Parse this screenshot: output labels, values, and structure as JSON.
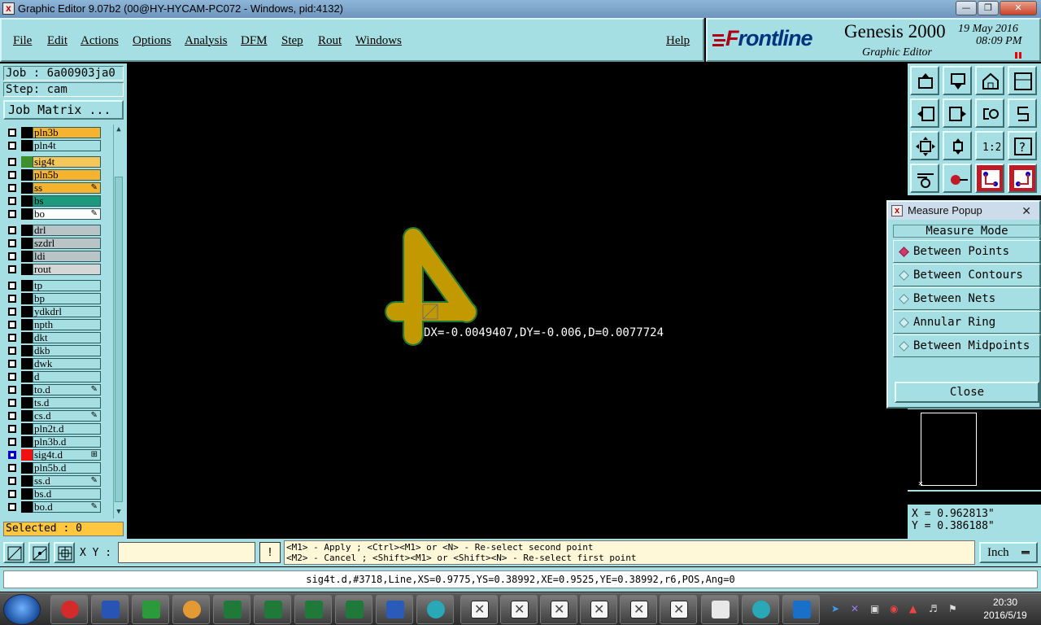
{
  "window": {
    "title": "Graphic Editor 9.07b2 (00@HY-HYCAM-PC072 - Windows, pid:4132)",
    "controls": [
      "minimize",
      "maximize",
      "close"
    ]
  },
  "menubar": {
    "items": [
      "File",
      "Edit",
      "Actions",
      "Options",
      "Analysis",
      "DFM",
      "Step",
      "Rout",
      "Windows"
    ],
    "help": "Help"
  },
  "brand": {
    "logo_first": "F",
    "logo_rest": "rontline",
    "product": "Genesis 2000",
    "subtitle": "Graphic Editor",
    "date": "19 May 2016",
    "time": "08:09 PM"
  },
  "job": {
    "job_label": "Job : 6a00903ja0",
    "step_label": "Step: cam",
    "matrix_button": "Job Matrix ...",
    "selected": "Selected : 0"
  },
  "layers": [
    {
      "name": "pln3b",
      "color": "#f5b330",
      "sq": "#000",
      "checked": false,
      "mark": ""
    },
    {
      "name": "pln4t",
      "color": "#a6dfe3",
      "sq": "#000",
      "checked": false,
      "mark": ""
    },
    {
      "name": "sig4t",
      "color": "#f5c65a",
      "sq": "#3f8f2f",
      "checked": false,
      "mark": ""
    },
    {
      "name": "pln5b",
      "color": "#f5b330",
      "sq": "#000",
      "checked": false,
      "mark": ""
    },
    {
      "name": "ss",
      "color": "#f5b330",
      "sq": "#000",
      "checked": false,
      "mark": "✎"
    },
    {
      "name": "bs",
      "color": "#1d9a7e",
      "sq": "#000",
      "checked": false,
      "mark": ""
    },
    {
      "name": "bo",
      "color": "#ffffff",
      "sq": "#000",
      "checked": false,
      "mark": "✎"
    },
    {
      "name": "drl",
      "color": "#b8c4c6",
      "sq": "#000",
      "checked": false,
      "mark": ""
    },
    {
      "name": "szdrl",
      "color": "#b8c4c6",
      "sq": "#000",
      "checked": false,
      "mark": ""
    },
    {
      "name": "ldi",
      "color": "#b8c4c6",
      "sq": "#000",
      "checked": false,
      "mark": ""
    },
    {
      "name": "rout",
      "color": "#d6d6d6",
      "sq": "#000",
      "checked": false,
      "mark": ""
    },
    {
      "name": "tp",
      "color": "#a6dfe3",
      "sq": "#000",
      "checked": false,
      "mark": ""
    },
    {
      "name": "bp",
      "color": "#a6dfe3",
      "sq": "#000",
      "checked": false,
      "mark": ""
    },
    {
      "name": "ydkdrl",
      "color": "#a6dfe3",
      "sq": "#000",
      "checked": false,
      "mark": ""
    },
    {
      "name": "npth",
      "color": "#a6dfe3",
      "sq": "#000",
      "checked": false,
      "mark": ""
    },
    {
      "name": "dkt",
      "color": "#a6dfe3",
      "sq": "#000",
      "checked": false,
      "mark": ""
    },
    {
      "name": "dkb",
      "color": "#a6dfe3",
      "sq": "#000",
      "checked": false,
      "mark": ""
    },
    {
      "name": "dwk",
      "color": "#a6dfe3",
      "sq": "#000",
      "checked": false,
      "mark": ""
    },
    {
      "name": "d",
      "color": "#a6dfe3",
      "sq": "#000",
      "checked": false,
      "mark": ""
    },
    {
      "name": "to.d",
      "color": "#a6dfe3",
      "sq": "#000",
      "checked": false,
      "mark": "✎"
    },
    {
      "name": "ts.d",
      "color": "#a6dfe3",
      "sq": "#000",
      "checked": false,
      "mark": ""
    },
    {
      "name": "cs.d",
      "color": "#a6dfe3",
      "sq": "#000",
      "checked": false,
      "mark": "✎"
    },
    {
      "name": "pln2t.d",
      "color": "#a6dfe3",
      "sq": "#000",
      "checked": false,
      "mark": ""
    },
    {
      "name": "pln3b.d",
      "color": "#a6dfe3",
      "sq": "#000",
      "checked": false,
      "mark": ""
    },
    {
      "name": "sig4t.d",
      "color": "#a6dfe3",
      "sq": "#ee1111",
      "checked": true,
      "mark": "⊞"
    },
    {
      "name": "pln5b.d",
      "color": "#a6dfe3",
      "sq": "#000",
      "checked": false,
      "mark": ""
    },
    {
      "name": "ss.d",
      "color": "#a6dfe3",
      "sq": "#000",
      "checked": false,
      "mark": "✎"
    },
    {
      "name": "bs.d",
      "color": "#a6dfe3",
      "sq": "#000",
      "checked": false,
      "mark": ""
    },
    {
      "name": "bo.d",
      "color": "#a6dfe3",
      "sq": "#000",
      "checked": false,
      "mark": "✎"
    }
  ],
  "canvas": {
    "measure_text": "DX=-0.0049407,DY=-0.006,D=0.0077724",
    "feature_color": "#c29a00"
  },
  "measure_popup": {
    "title": "Measure Popup",
    "mode_title": "Measure Mode",
    "options": [
      "Between Points",
      "Between Contours",
      "Between Nets",
      "Annular Ring",
      "Between Midpoints"
    ],
    "selected": "Between Points",
    "close": "Close"
  },
  "coords": {
    "x": "X = 0.962813\"",
    "y": "Y = 0.386188\""
  },
  "bottom": {
    "xy_label": "X Y :",
    "xy_value": "",
    "warn": "!",
    "hint1": "<M1> - Apply  ; <Ctrl><M1> or <N> - Re-select second point",
    "hint2": "<M2> - Cancel ; <Shift><M1> or <Shift><N> - Re-select first point",
    "units": "Inch",
    "status": "sig4t.d,#3718,Line,XS=0.9775,YS=0.38992,XE=0.9525,YE=0.38992,r6,POS,Ang=0"
  },
  "taskbar": {
    "time": "20:30",
    "date": "2016/5/19"
  }
}
